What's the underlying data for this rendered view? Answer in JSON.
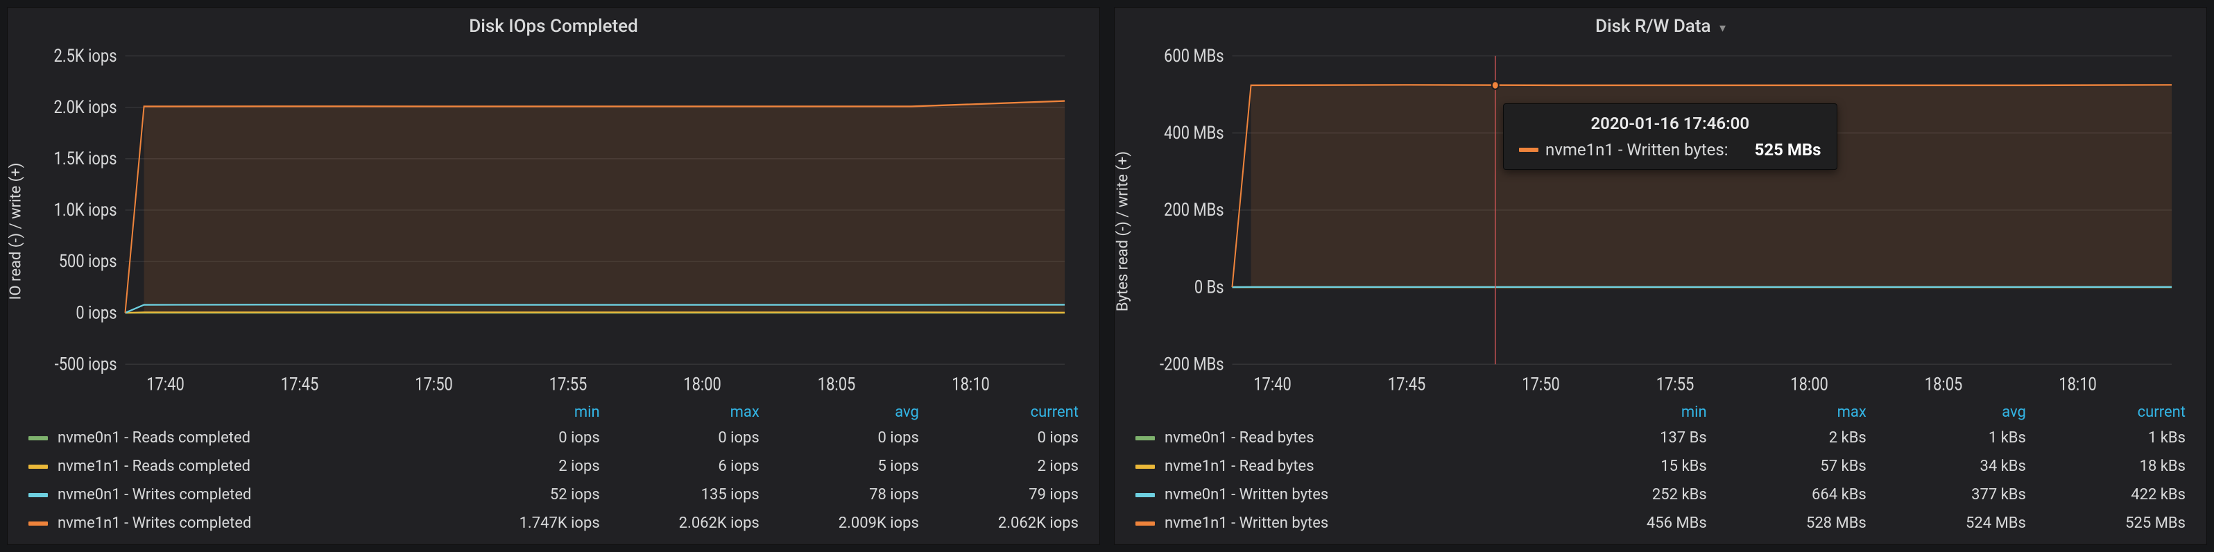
{
  "x_ticks": [
    "17:40",
    "17:45",
    "17:50",
    "17:55",
    "18:00",
    "18:05",
    "18:10"
  ],
  "colors": {
    "nvme0_read": "#7eb26d",
    "nvme1_read": "#eab839",
    "nvme0_write": "#6ed0e0",
    "nvme1_write": "#ef843c"
  },
  "left": {
    "title": "Disk IOps Completed",
    "y_label": "IO read (-) / write (+)",
    "y_ticks": [
      "-500 iops",
      "0 iops",
      "500 iops",
      "1.0K iops",
      "1.5K iops",
      "2.0K iops",
      "2.5K iops"
    ],
    "header": {
      "name": "",
      "min": "min",
      "max": "max",
      "avg": "avg",
      "current": "current"
    },
    "rows": [
      {
        "color": "nvme0_read",
        "name": "nvme0n1 - Reads completed",
        "min": "0 iops",
        "max": "0 iops",
        "avg": "0 iops",
        "current": "0 iops"
      },
      {
        "color": "nvme1_read",
        "name": "nvme1n1 - Reads completed",
        "min": "2 iops",
        "max": "6 iops",
        "avg": "5 iops",
        "current": "2 iops"
      },
      {
        "color": "nvme0_write",
        "name": "nvme0n1 - Writes completed",
        "min": "52 iops",
        "max": "135 iops",
        "avg": "78 iops",
        "current": "79 iops"
      },
      {
        "color": "nvme1_write",
        "name": "nvme1n1 - Writes completed",
        "min": "1.747K iops",
        "max": "2.062K iops",
        "avg": "2.009K iops",
        "current": "2.062K iops"
      }
    ]
  },
  "right": {
    "title": "Disk R/W Data",
    "y_label": "Bytes read (-) / write (+)",
    "y_ticks": [
      "-200 MBs",
      "0 Bs",
      "200 MBs",
      "400 MBs",
      "600 MBs"
    ],
    "header": {
      "name": "",
      "min": "min",
      "max": "max",
      "avg": "avg",
      "current": "current"
    },
    "rows": [
      {
        "color": "nvme0_read",
        "name": "nvme0n1 - Read bytes",
        "min": "137 Bs",
        "max": "2 kBs",
        "avg": "1 kBs",
        "current": "1 kBs"
      },
      {
        "color": "nvme1_read",
        "name": "nvme1n1 - Read bytes",
        "min": "15 kBs",
        "max": "57 kBs",
        "avg": "34 kBs",
        "current": "18 kBs"
      },
      {
        "color": "nvme0_write",
        "name": "nvme0n1 - Written bytes",
        "min": "252 kBs",
        "max": "664 kBs",
        "avg": "377 kBs",
        "current": "422 kBs"
      },
      {
        "color": "nvme1_write",
        "name": "nvme1n1 - Written bytes",
        "min": "456 MBs",
        "max": "528 MBs",
        "avg": "524 MBs",
        "current": "525 MBs"
      }
    ],
    "tooltip": {
      "time": "2020-01-16 17:46:00",
      "label": "nvme1n1 - Written bytes:",
      "value": "525 MBs"
    }
  },
  "chart_data": [
    {
      "type": "line",
      "title": "Disk IOps Completed",
      "xlabel": "",
      "ylabel": "IO read (-) / write (+)",
      "ylim": [
        -500,
        2500
      ],
      "x": [
        "17:40",
        "17:45",
        "17:50",
        "17:55",
        "18:00",
        "18:05",
        "18:10"
      ],
      "series": [
        {
          "name": "nvme0n1 - Reads completed",
          "color": "#7eb26d",
          "values": [
            0,
            0,
            0,
            0,
            0,
            0,
            0
          ]
        },
        {
          "name": "nvme1n1 - Reads completed",
          "color": "#eab839",
          "values": [
            5,
            5,
            5,
            5,
            5,
            5,
            2
          ]
        },
        {
          "name": "nvme0n1 - Writes completed",
          "color": "#6ed0e0",
          "values": [
            78,
            80,
            78,
            78,
            78,
            78,
            79
          ]
        },
        {
          "name": "nvme1n1 - Writes completed",
          "color": "#ef843c",
          "values": [
            2009,
            2010,
            2009,
            2009,
            2009,
            2009,
            2062
          ]
        }
      ]
    },
    {
      "type": "line",
      "title": "Disk R/W Data",
      "xlabel": "",
      "ylabel": "Bytes read (-) / write (+)",
      "ylim": [
        -200,
        600
      ],
      "unit": "MBs",
      "x": [
        "17:40",
        "17:45",
        "17:50",
        "17:55",
        "18:00",
        "18:05",
        "18:10"
      ],
      "series": [
        {
          "name": "nvme0n1 - Read bytes",
          "color": "#7eb26d",
          "values": [
            0,
            0,
            0,
            0,
            0,
            0,
            0
          ]
        },
        {
          "name": "nvme1n1 - Read bytes",
          "color": "#eab839",
          "values": [
            0.034,
            0.034,
            0.034,
            0.034,
            0.034,
            0.034,
            0.018
          ]
        },
        {
          "name": "nvme0n1 - Written bytes",
          "color": "#6ed0e0",
          "values": [
            0.377,
            0.377,
            0.377,
            0.377,
            0.377,
            0.377,
            0.422
          ]
        },
        {
          "name": "nvme1n1 - Written bytes",
          "color": "#ef843c",
          "values": [
            524,
            525,
            524,
            524,
            524,
            524,
            525
          ]
        }
      ],
      "hover": {
        "x": "17:46",
        "series": "nvme1n1 - Written bytes",
        "value": 525
      }
    }
  ]
}
